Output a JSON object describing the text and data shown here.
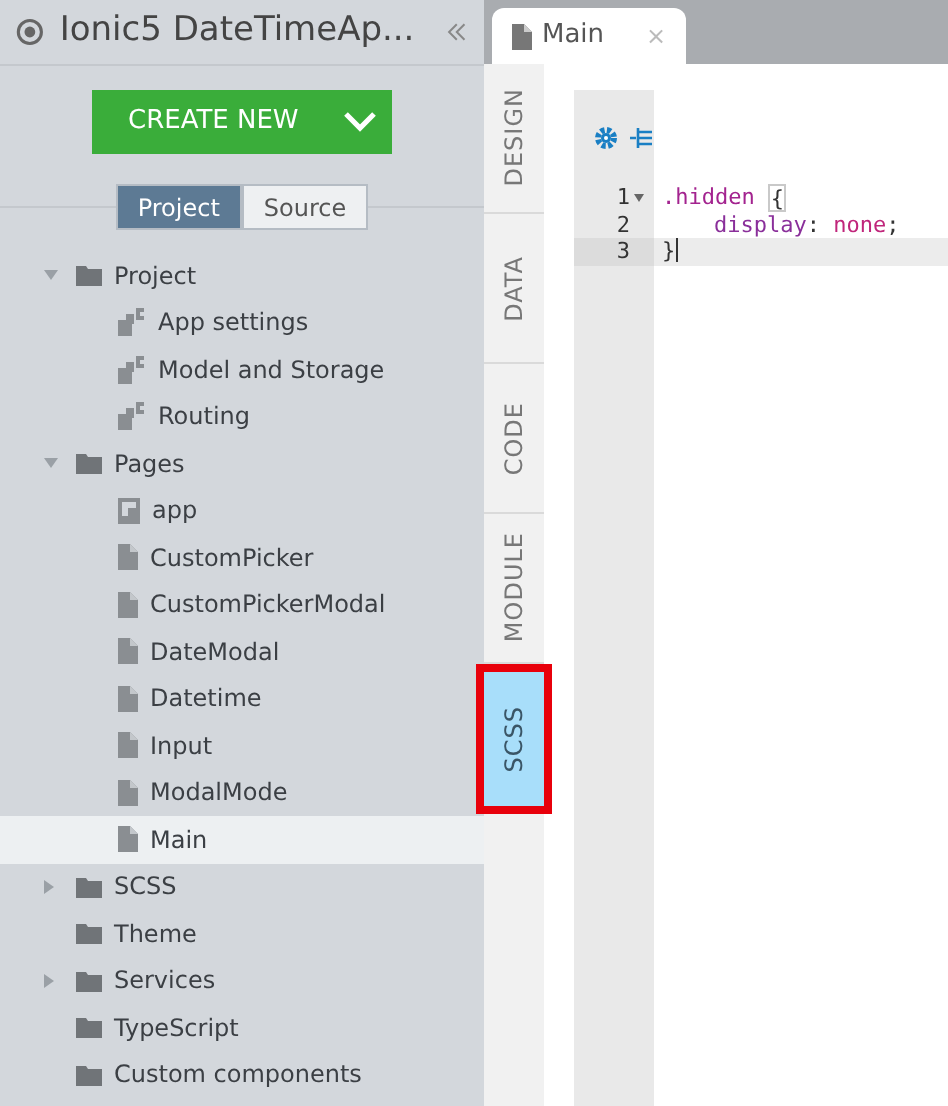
{
  "sidebar": {
    "title": "Ionic5 DateTimeAp...",
    "create_button": "CREATE NEW",
    "view_toggle": [
      {
        "label": "Project",
        "selected": true
      },
      {
        "label": "Source",
        "selected": false
      }
    ],
    "tree": [
      {
        "label": "Project",
        "kind": "folder",
        "expanded": true,
        "selected": false,
        "children": [
          {
            "label": "App settings",
            "kind": "settings",
            "selected": false
          },
          {
            "label": "Model and Storage",
            "kind": "settings",
            "selected": false
          },
          {
            "label": "Routing",
            "kind": "settings",
            "selected": false
          }
        ]
      },
      {
        "label": "Pages",
        "kind": "folder",
        "expanded": true,
        "selected": false,
        "children": [
          {
            "label": "app",
            "kind": "app",
            "selected": false
          },
          {
            "label": "CustomPicker",
            "kind": "page",
            "selected": false
          },
          {
            "label": "CustomPickerModal",
            "kind": "page",
            "selected": false
          },
          {
            "label": "DateModal",
            "kind": "page",
            "selected": false
          },
          {
            "label": "Datetime",
            "kind": "page",
            "selected": false
          },
          {
            "label": "Input",
            "kind": "page",
            "selected": false
          },
          {
            "label": "ModalMode",
            "kind": "page",
            "selected": false
          },
          {
            "label": "Main",
            "kind": "page",
            "selected": true
          }
        ]
      },
      {
        "label": "SCSS",
        "kind": "folder",
        "expanded": false,
        "selected": false
      },
      {
        "label": "Theme",
        "kind": "folder",
        "selected": false
      },
      {
        "label": "Services",
        "kind": "folder",
        "expanded": false,
        "selected": false
      },
      {
        "label": "TypeScript",
        "kind": "folder",
        "selected": false
      },
      {
        "label": "Custom components",
        "kind": "folder",
        "selected": false
      }
    ]
  },
  "editor_tabs": [
    {
      "label": "Main",
      "close": "×",
      "selected": true
    }
  ],
  "side_tabs": [
    {
      "label": "DESIGN",
      "selected": false
    },
    {
      "label": "DATA",
      "selected": false
    },
    {
      "label": "CODE",
      "selected": false
    },
    {
      "label": "MODULE",
      "selected": false
    },
    {
      "label": "SCSS",
      "selected": true
    }
  ],
  "code": [
    {
      "number": "1",
      "foldable": true,
      "active": false,
      "tokens": [
        {
          "kind": "selector",
          "text": ".hidden"
        },
        {
          "kind": "bracket",
          "text": "{"
        }
      ]
    },
    {
      "number": "2",
      "foldable": false,
      "active": false,
      "indented": true,
      "tokens": [
        {
          "kind": "property",
          "text": "display"
        },
        {
          "kind": "plain",
          "text": ": "
        },
        {
          "kind": "value",
          "text": "none"
        },
        {
          "kind": "plain",
          "text": ";"
        }
      ]
    },
    {
      "number": "3",
      "foldable": false,
      "active": true,
      "tokens": [
        {
          "kind": "plain",
          "text": "}"
        }
      ]
    }
  ]
}
